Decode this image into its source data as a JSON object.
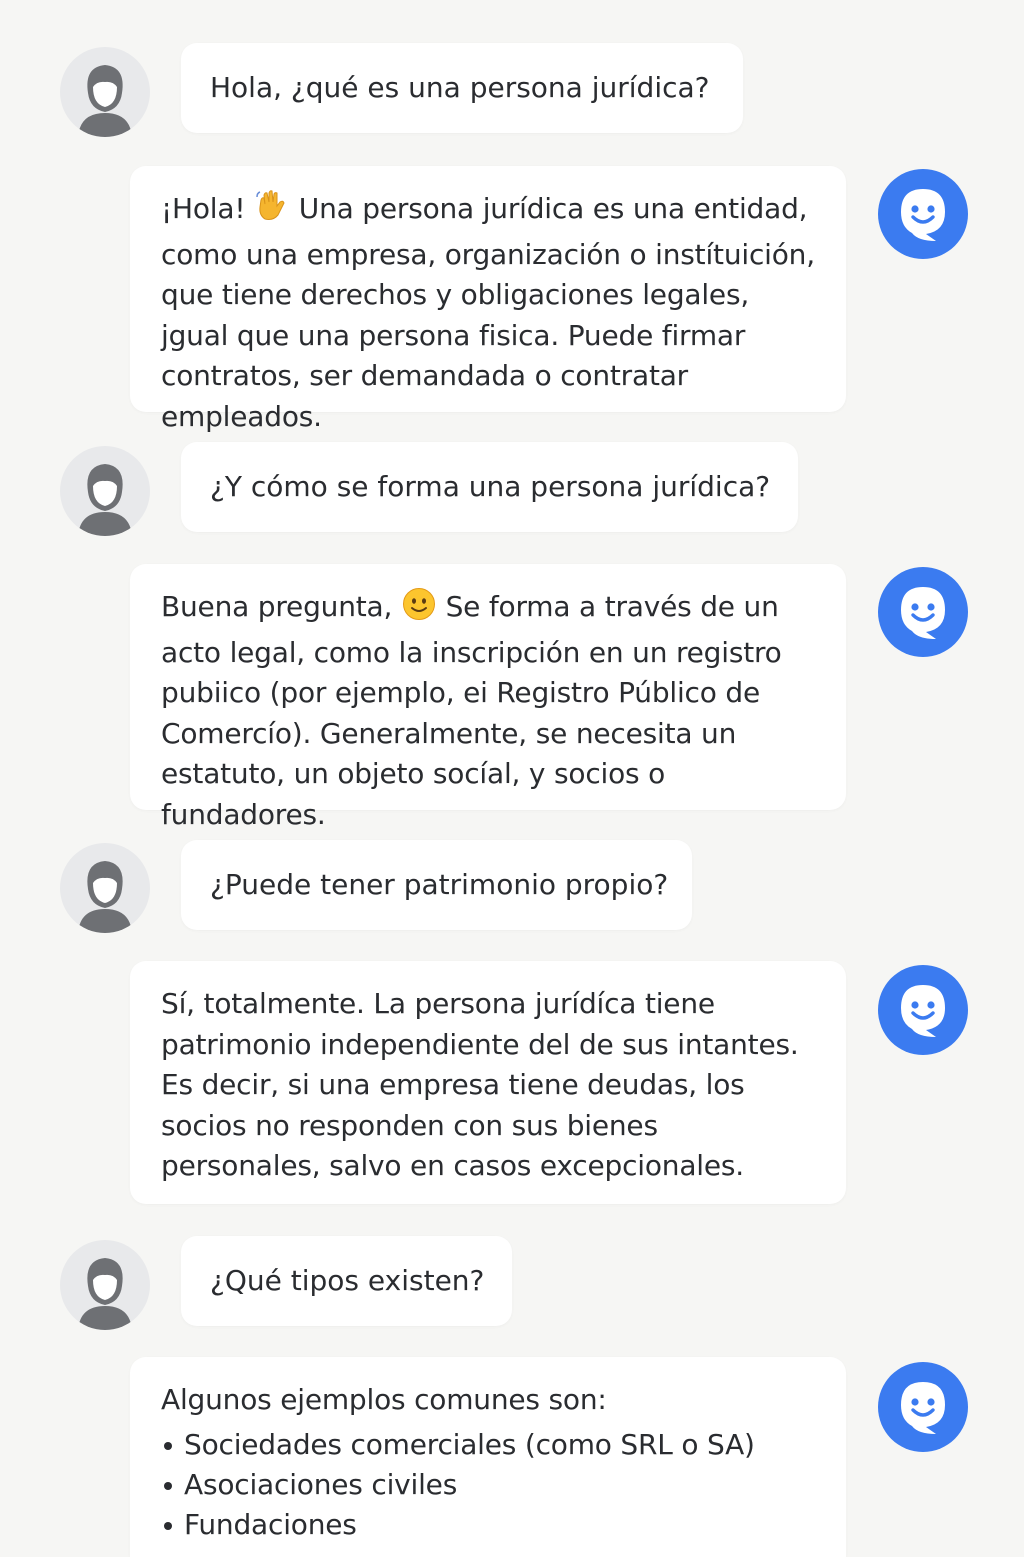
{
  "conversation": {
    "messages": [
      {
        "role": "user",
        "text": "Hola, ¿qué es una persona jurídica?"
      },
      {
        "role": "bot",
        "before_emoji": "¡Hola! ",
        "emoji": "waving-hand-emoji",
        "after_emoji": " Una persona jurídica es una entidad, como una empresa, organización o instítuición, que tiene derechos y obligaciones legales, jgual que una persona fisica. Puede firmar contratos, ser demandada o contratar empleados."
      },
      {
        "role": "user",
        "text": "¿Y cómo se forma una persona jurídica?"
      },
      {
        "role": "bot",
        "before_emoji": "Buena pregunta, ",
        "emoji": "smiling-face-emoji",
        "after_emoji": " Se forma a través de un acto legal, como la inscripción en un registro pubiico (por ejemplo, ei Registro Público de Comercío). Generalmente, se necesita un estatuto, un objeto socíal, y socios o fundadores."
      },
      {
        "role": "user",
        "text": "¿Puede tener patrimonio propio?"
      },
      {
        "role": "bot",
        "text": "Sí, totalmente. La persona jurídíca tiene patrimonio independiente del de sus intantes. Es decir, si una empresa tiene deudas, los socios no responden con sus bienes personales, salvo en casos excepcionales."
      },
      {
        "role": "user",
        "text": "¿Qué tipos existen?"
      },
      {
        "role": "bot",
        "text": "Algunos ejemplos comunes son:",
        "list": [
          "Sociedades comerciales (como SRL o SA)",
          "Asociaciones civiles",
          "Fundaciones"
        ]
      }
    ]
  },
  "icons": {
    "user_avatar": "user-avatar-icon",
    "bot_avatar": "chatbot-smiley-icon"
  },
  "colors": {
    "background": "#f6f6f4",
    "bubble": "#ffffff",
    "user_avatar_bg": "#e8e9eb",
    "user_avatar_fg": "#6e7074",
    "bot_avatar_bg": "#3b7bf0",
    "text": "#2a2c30"
  }
}
